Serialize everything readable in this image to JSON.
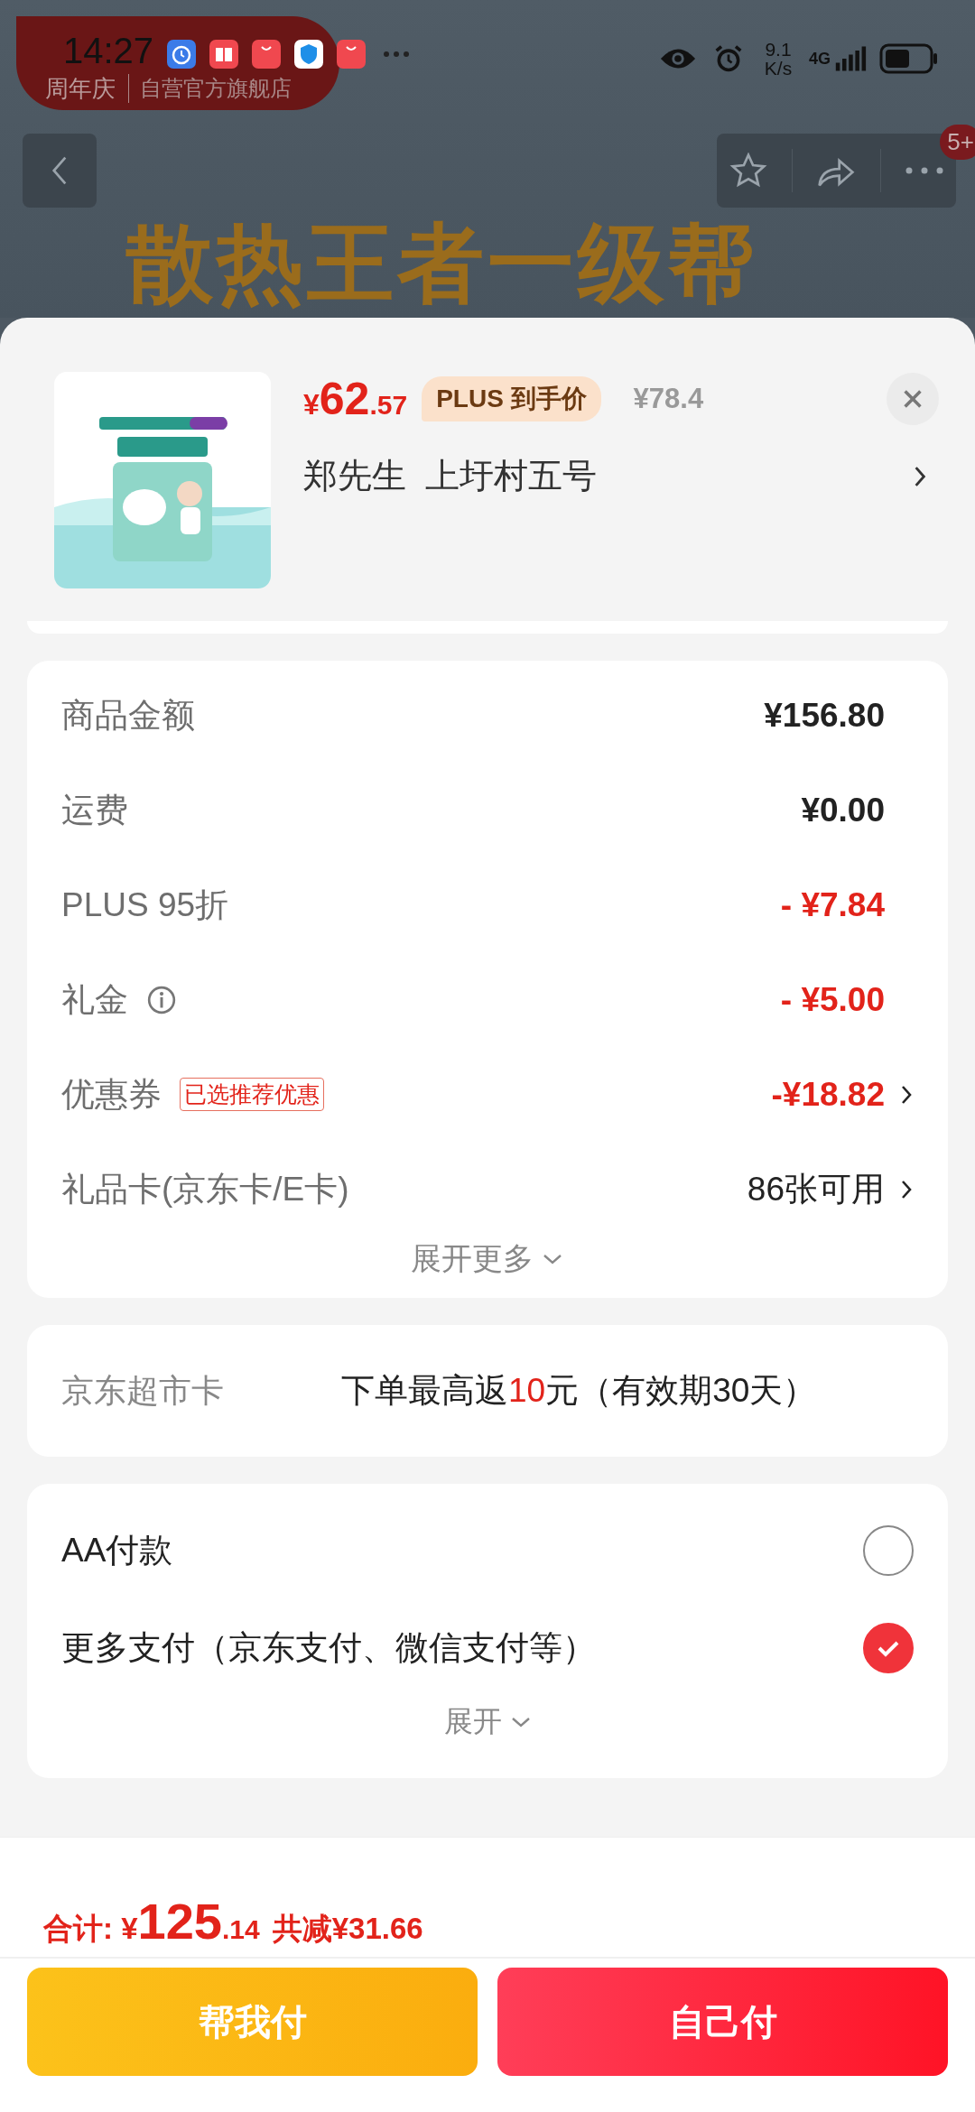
{
  "status_bar": {
    "time": "14:27",
    "net_speed": "9.1 K/s",
    "network": "4G"
  },
  "store_badge": {
    "anniversary_label": "周年庆",
    "store": "自营官方旗舰店"
  },
  "banner": {
    "title": "散热王者一级帮"
  },
  "top_bar": {
    "badge": "5+"
  },
  "product": {
    "price_symbol": "¥",
    "price_int": "62",
    "price_dec": ".57",
    "plus_tag": "PLUS 到手价",
    "original_price": "¥78.4",
    "address": "郑先生  上圩村五号"
  },
  "fees": [
    {
      "label": "商品金额",
      "value": "¥156.80",
      "kind": "amount",
      "arrow": false,
      "info": false
    },
    {
      "label": "运费",
      "value": "¥0.00",
      "kind": "amount",
      "arrow": false,
      "info": false
    },
    {
      "label": "PLUS 95折",
      "value": "- ¥7.84",
      "kind": "discount",
      "arrow": false,
      "info": false
    },
    {
      "label": "礼金",
      "value": "- ¥5.00",
      "kind": "discount",
      "arrow": false,
      "info": true
    },
    {
      "label": "优惠券",
      "tag": "已选推荐优惠",
      "value": "-¥18.82",
      "kind": "discount",
      "arrow": true,
      "info": false
    },
    {
      "label": "礼品卡(京东卡/E卡)",
      "value": "86张可用",
      "kind": "count",
      "arrow": true,
      "info": false
    }
  ],
  "expand_more": "展开更多",
  "supermarket_card": {
    "label": "京东超市卡",
    "text_before": "下单最高返",
    "highlight": "10",
    "text_after": "元（有效期30天）"
  },
  "payment": {
    "options": [
      {
        "label": "AA付款",
        "selected": false
      },
      {
        "label": "更多支付（京东支付、微信支付等）",
        "selected": true
      }
    ],
    "expand": "展开"
  },
  "footer": {
    "total_label": "合计:",
    "currency": "¥",
    "total_int": "125",
    "total_dec": ".14",
    "saving": "共减¥31.66",
    "buttons": [
      {
        "label": "帮我付",
        "kind": "friend"
      },
      {
        "label": "自己付",
        "kind": "self"
      }
    ]
  }
}
